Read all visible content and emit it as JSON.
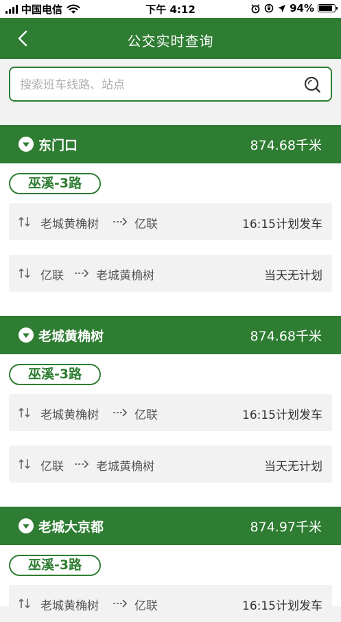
{
  "status_bar": {
    "carrier": "中国电信",
    "time": "下午 4:12",
    "battery": "94%",
    "battery_level": 0.94
  },
  "nav": {
    "title": "公交实时查询",
    "back_icon": "chevron-left-icon"
  },
  "search": {
    "placeholder": "搜索班车线路、站点",
    "value": "",
    "icon": "search-icon"
  },
  "stops": [
    {
      "name": "东门口",
      "distance": "874.68千米",
      "route": "巫溪-3路",
      "trips": [
        {
          "from": "老城黄桷树",
          "to": "亿联",
          "status": "16:15计划发车"
        },
        {
          "from": "亿联",
          "to": "老城黄桷树",
          "status": "当天无计划"
        }
      ]
    },
    {
      "name": "老城黄桷树",
      "distance": "874.68千米",
      "route": "巫溪-3路",
      "trips": [
        {
          "from": "老城黄桷树",
          "to": "亿联",
          "status": "16:15计划发车"
        },
        {
          "from": "亿联",
          "to": "老城黄桷树",
          "status": "当天无计划"
        }
      ]
    },
    {
      "name": "老城大京都",
      "distance": "874.97千米",
      "route": "巫溪-3路",
      "trips": [
        {
          "from": "老城黄桷树",
          "to": "亿联",
          "status": "16:15计划发车"
        }
      ]
    }
  ],
  "colors": {
    "primary": "#2e7d32",
    "background": "#f2f2f2",
    "row_background": "#f2f2f2"
  }
}
